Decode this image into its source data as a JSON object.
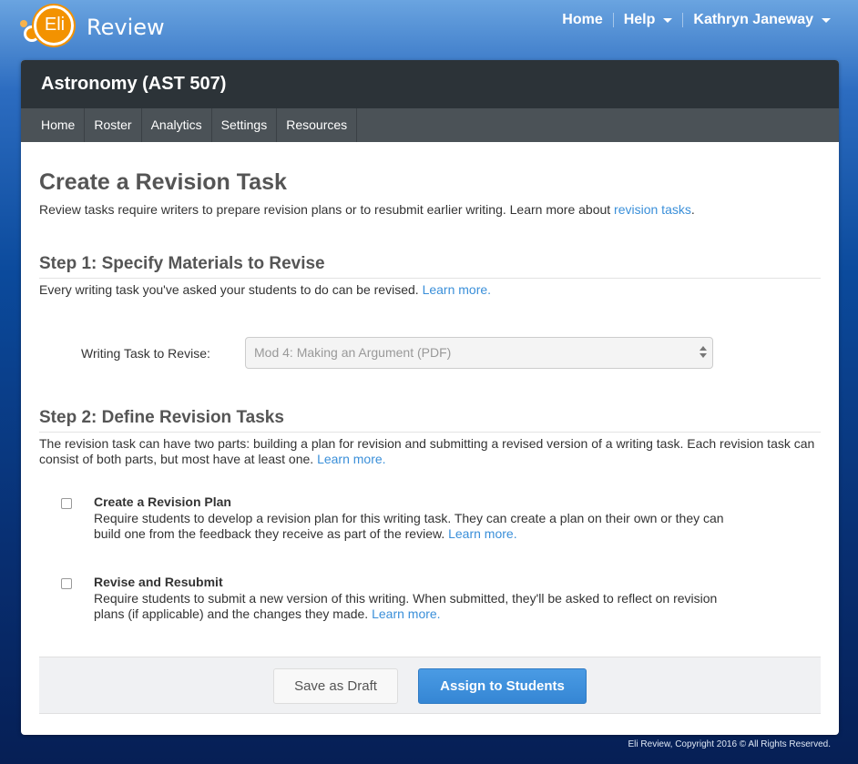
{
  "brand": {
    "logo_text": "Eli",
    "name": "Review"
  },
  "topnav": {
    "home": "Home",
    "help": "Help",
    "user": "Kathryn Janeway"
  },
  "course": {
    "title": "Astronomy (AST 507)",
    "tabs": [
      {
        "label": "Home"
      },
      {
        "label": "Roster"
      },
      {
        "label": "Analytics"
      },
      {
        "label": "Settings"
      },
      {
        "label": "Resources"
      }
    ]
  },
  "page": {
    "title": "Create a Revision Task",
    "intro": "Review tasks require writers to prepare revision plans or to resubmit earlier writing. Learn more about ",
    "intro_link": "revision tasks",
    "intro_end": "."
  },
  "step1": {
    "heading": "Step 1: Specify Materials to Revise",
    "desc": "Every writing task you've asked your students to do can be revised. ",
    "learn_more": "Learn more.",
    "field_label": "Writing Task to Revise:",
    "selected_value": "Mod 4: Making an Argument (PDF)"
  },
  "step2": {
    "heading": "Step 2: Define Revision Tasks",
    "desc": "The revision task can have two parts: building a plan for revision and submitting a revised version of a writing task. Each revision task can consist of both parts, but most have at least one. ",
    "learn_more": "Learn more.",
    "options": [
      {
        "title": "Create a Revision Plan",
        "desc": "Require students to develop a revision plan for this writing task. They can create a plan on their own or they can build one from the feedback they receive as part of the review. ",
        "learn_more": "Learn more.",
        "checked": false
      },
      {
        "title": "Revise and Resubmit",
        "desc": "Require students to submit a new version of this writing. When submitted, they'll be asked to reflect on revision plans (if applicable) and the changes they made. ",
        "learn_more": "Learn more.",
        "checked": false
      }
    ]
  },
  "actions": {
    "save_draft": "Save as Draft",
    "assign": "Assign to Students"
  },
  "footer": {
    "copyright": "Eli Review, Copyright 2016 © All Rights Reserved."
  },
  "colors": {
    "link": "#3a8fd9",
    "primary_button": "#3a8fd9",
    "header_dark": "#2c3338",
    "logo_orange": "#f39200"
  }
}
